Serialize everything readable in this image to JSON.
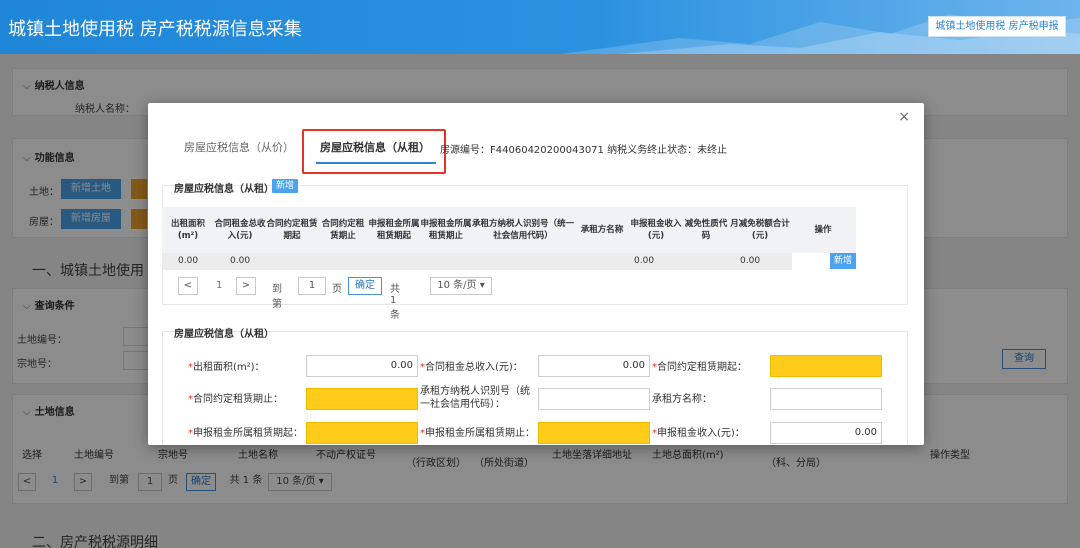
{
  "header": {
    "title": "城镇土地使用税 房产税税源信息采集",
    "right_button": "城镇土地使用税 房产税申报"
  },
  "background": {
    "taxpayer_section": "纳税人信息",
    "taxpayer_name_label": "纳税人名称：",
    "function_section": "功能信息",
    "land_label": "土地：",
    "land_add_button": "新增土地",
    "house_label": "房屋：",
    "house_add_button": "新增房屋",
    "section_one": "一、城镇土地使用",
    "query_section": "查询条件",
    "land_no_label": "土地编号：",
    "parcel_no_label": "宗地号：",
    "query_button": "查询",
    "land_info_section": "土地信息",
    "table_headers": [
      "选择",
      "土地编号",
      "宗地号",
      "土地名称",
      "不动产权证号",
      "（行政区划）",
      "（所处街道）",
      "土地坐落详细地址",
      "土地总面积(m²)",
      "（科、分局）",
      "操作类型"
    ],
    "pager": {
      "prev": "<",
      "page": "1",
      "next": ">",
      "goto": "到第",
      "page_input": "1",
      "page_unit": "页",
      "confirm": "确定",
      "total": "共 1 条",
      "per_page": "10 条/页 ▾"
    },
    "section_two": "二、房产税税源明细"
  },
  "modal": {
    "close": "×",
    "tabs": [
      "房屋应税信息（从价）",
      "房屋应税信息（从租）"
    ],
    "active_tab": 1,
    "source_info": "房源编号：F44060420200043071 纳税义务终止状态：未终止",
    "list_section": {
      "title": "房屋应税信息（从租）",
      "new_badge": "新增",
      "columns": [
        "出租面积 (m²)",
        "合同租金总收入(元)",
        "合同约定租赁期起",
        "合同约定租赁期止",
        "申报租金所属租赁期起",
        "申报租金所属租赁期止",
        "承租方纳税人识别号（统一社会信用代码）",
        "承租方名称",
        "申报租金收入(元)",
        "减免性质代码",
        "月减免税额合计(元)",
        "操作"
      ],
      "row": {
        "area": "0.00",
        "total_income": "0.00",
        "declared_income": "0.00",
        "monthly_relief": "0.00",
        "action": "新增"
      },
      "pager": {
        "prev": "<",
        "page": "1",
        "next": ">",
        "goto": "到第",
        "page_input": "1",
        "page_unit": "页",
        "confirm": "确定",
        "total": "共 1 条",
        "per_page": "10 条/页 ▾"
      }
    },
    "form_section": {
      "title": "房屋应税信息（从租）",
      "fields": {
        "rent_area_label": "出租面积(m²)：",
        "rent_area_value": "0.00",
        "contract_income_label": "合同租金总收入(元)：",
        "contract_income_value": "0.00",
        "contract_start_label": "合同约定租赁期起：",
        "contract_end_label": "合同约定租赁期止：",
        "lessee_id_label": "承租方纳税人识别号（统一社会信用代码）：",
        "lessee_name_label": "承租方名称：",
        "declare_start_label": "申报租金所属租赁期起：",
        "declare_end_label": "申报租金所属租赁期止：",
        "declare_income_label": "申报租金收入(元)：",
        "declare_income_value": "0.00"
      }
    }
  }
}
